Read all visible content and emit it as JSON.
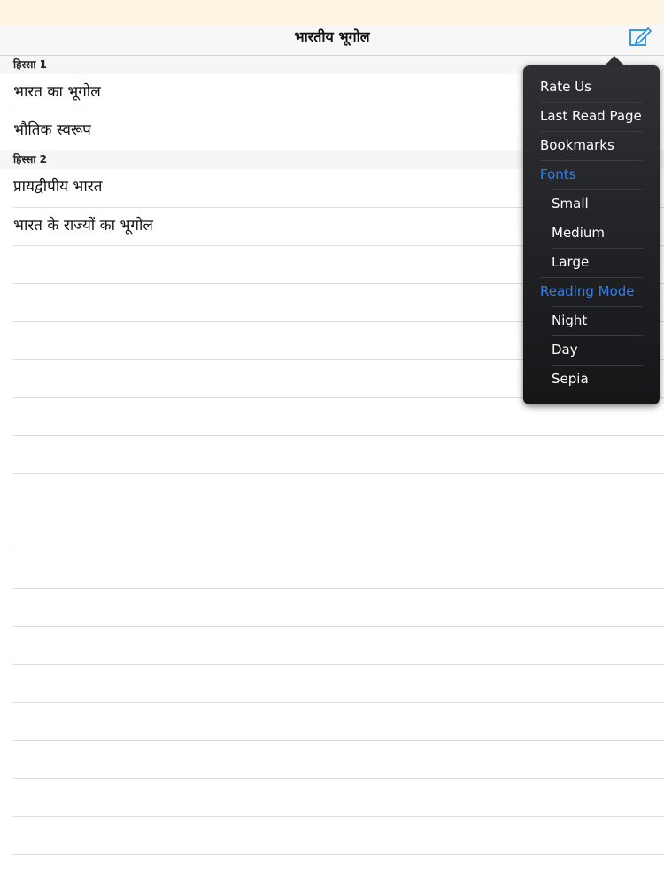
{
  "nav": {
    "title": "भारतीय भूगोल",
    "edit_icon": "compose-icon"
  },
  "sections": [
    {
      "title": "हिस्सा 1",
      "rows": [
        "भारत का भूगोल",
        "भौतिक स्वरूप"
      ]
    },
    {
      "title": "हिस्सा 2",
      "rows": [
        "प्रायद्वीपीय भारत",
        "भारत के राज्यों का भूगोल"
      ]
    }
  ],
  "menu": {
    "rate_us": "Rate Us",
    "last_read_page": "Last Read Page",
    "bookmarks": "Bookmarks",
    "fonts_heading": "Fonts",
    "fonts": [
      "Small",
      "Medium",
      "Large"
    ],
    "reading_mode_heading": "Reading Mode",
    "reading_modes": [
      "Night",
      "Day",
      "Sepia"
    ]
  },
  "colors": {
    "status_bar": "#fdf3e1",
    "menu_heading": "#2f7ff0",
    "accent_icon": "#2a8ae0"
  }
}
